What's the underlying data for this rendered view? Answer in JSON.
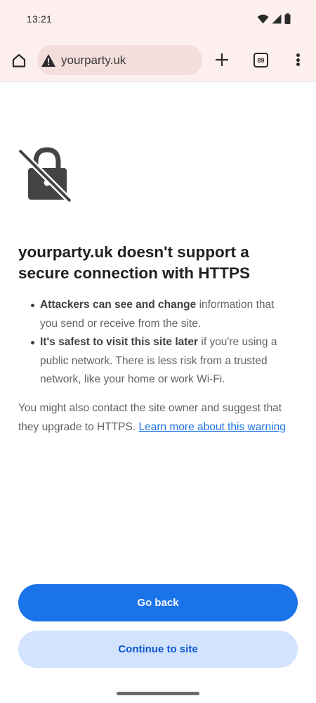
{
  "status_bar": {
    "time": "13:21",
    "icons": [
      "wifi-icon",
      "signal-icon",
      "battery-icon"
    ]
  },
  "toolbar": {
    "url": "yourparty.uk",
    "tab_count": "89",
    "icons": [
      "home-icon",
      "warning-icon",
      "plus-icon",
      "tabs-icon",
      "more-vert-icon"
    ]
  },
  "page": {
    "headline": "yourparty.uk doesn't support a secure connection with HTTPS",
    "bullets": [
      {
        "bold": "Attackers can see and change",
        "text": " information that you send or receive from the site."
      },
      {
        "bold": "It's safest to visit this site later",
        "text": " if you're using a public network. There is less risk from a trusted network, like your home or work Wi-Fi."
      }
    ],
    "paragraph": "You might also contact the site owner and suggest that they upgrade to HTTPS. ",
    "learn_more_link": "Learn more about this warning"
  },
  "actions": {
    "go_back": "Go back",
    "continue": "Continue to site"
  },
  "colors": {
    "chrome_bg": "#fcefed",
    "omnibox_bg": "#f3dedb",
    "primary": "#1a73e8",
    "secondary_bg": "#d3e3fd",
    "secondary_text": "#0b57d0",
    "link": "#1a73e8"
  }
}
